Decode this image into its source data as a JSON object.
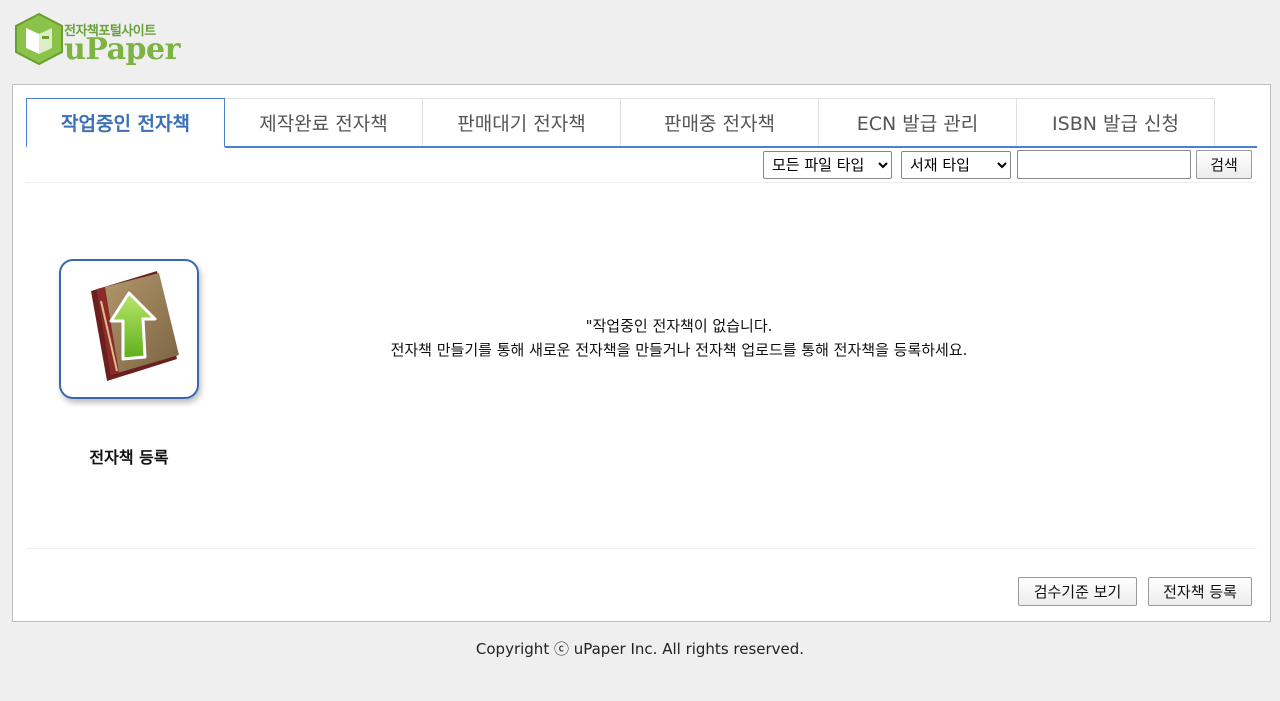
{
  "logo": {
    "tagline": "전자책포털사이트",
    "brand": "uPaper"
  },
  "tabs": [
    {
      "label": "작업중인 전자책",
      "active": true
    },
    {
      "label": "제작완료 전자책",
      "active": false
    },
    {
      "label": "판매대기 전자책",
      "active": false
    },
    {
      "label": "판매중 전자책",
      "active": false
    },
    {
      "label": "ECN 발급 관리",
      "active": false
    },
    {
      "label": "ISBN 발급 신청",
      "active": false
    }
  ],
  "filters": {
    "file_type": {
      "selected": "모든 파일 타입"
    },
    "book_type": {
      "selected": "서재 타입"
    },
    "search_value": "",
    "search_button": "검색"
  },
  "upload": {
    "caption": "전자책 등록",
    "icon": "book-upload-icon"
  },
  "empty_message": {
    "line1": "\"작업중인 전자책이 없습니다.",
    "line2": "전자책 만들기를 통해 새로운 전자책을 만들거나 전자책 업로드를 통해 전자책을 등록하세요."
  },
  "actions": {
    "criteria": "검수기준 보기",
    "register": "전자책 등록"
  },
  "footer": {
    "copyright": "Copyright ⓒ uPaper Inc. All rights reserved."
  },
  "colors": {
    "accent": "#4a7fd1",
    "active_tab_text": "#3b6fb6",
    "logo_green": "#7cb342"
  }
}
